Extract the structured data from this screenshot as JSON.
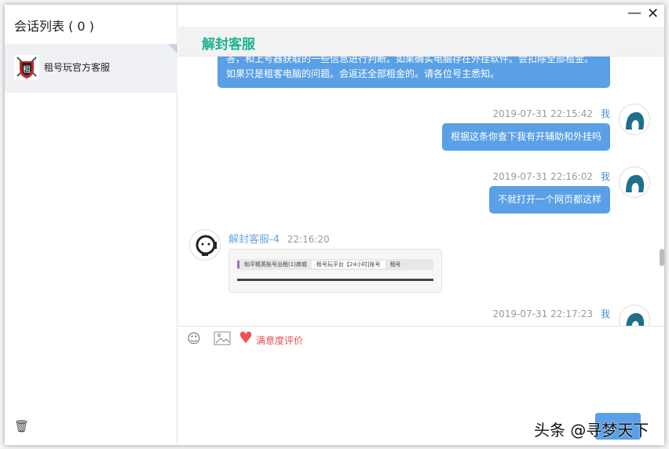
{
  "sidebar": {
    "title": "会话列表 ( 0 )",
    "conversations": [
      {
        "name": "租号玩官方客服"
      }
    ]
  },
  "header": {
    "title": "解封客服"
  },
  "messages": [
    {
      "from": "agent",
      "text_line1": "答，和上号器获取的一些信息进行判断。如果确实电脑存在外挂软件。会扣除全部租金。",
      "text_line2": "如果只是租客电脑的问题。会返还全部租金的。请各位号主悉知。"
    },
    {
      "from": "me",
      "time": "2019-07-31 22:15:42",
      "sender": "我",
      "text": "根据这条你查下我有开辅助和外挂吗"
    },
    {
      "from": "me",
      "time": "2019-07-31 22:16:02",
      "sender": "我",
      "text": "不就打开一个网页都这样"
    },
    {
      "from": "agent",
      "sender": "解封客服-4",
      "time": "22:16:20",
      "image_tabs": [
        "和平精英账号出租(1)商城",
        "租号玩平台【24小时]账号",
        "租号"
      ]
    },
    {
      "from": "me",
      "time": "2019-07-31 22:17:23",
      "sender": "我"
    }
  ],
  "toolbar": {
    "rate_label": "满意度评价"
  },
  "watermark": "头条 @寻梦天下",
  "colors": {
    "accent": "#1bb38f",
    "bubble": "#5aa0e6",
    "rate": "#e05252"
  }
}
